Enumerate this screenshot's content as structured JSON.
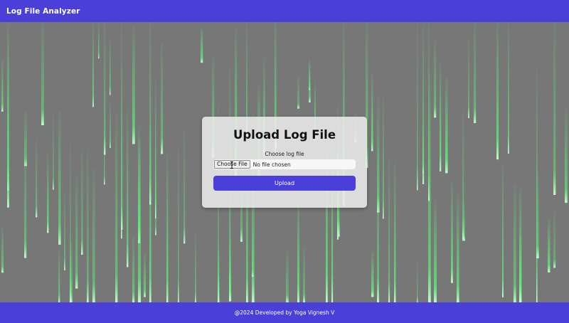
{
  "navbar": {
    "brand": "Log File Analyzer"
  },
  "upload_card": {
    "title": "Upload Log File",
    "choose_label": "Choose log file",
    "file_input": {
      "button_label": "Choose File",
      "status_text": "No file chosen"
    },
    "upload_button_label": "Upload"
  },
  "footer": {
    "text": "@2024 Developed by Yoga Vignesh V"
  },
  "colors": {
    "primary": "#4a3fd8",
    "background_gray": "#777777",
    "matrix_green": "#5cff7a",
    "card_background": "#ececec",
    "text_white": "#ffffff"
  }
}
